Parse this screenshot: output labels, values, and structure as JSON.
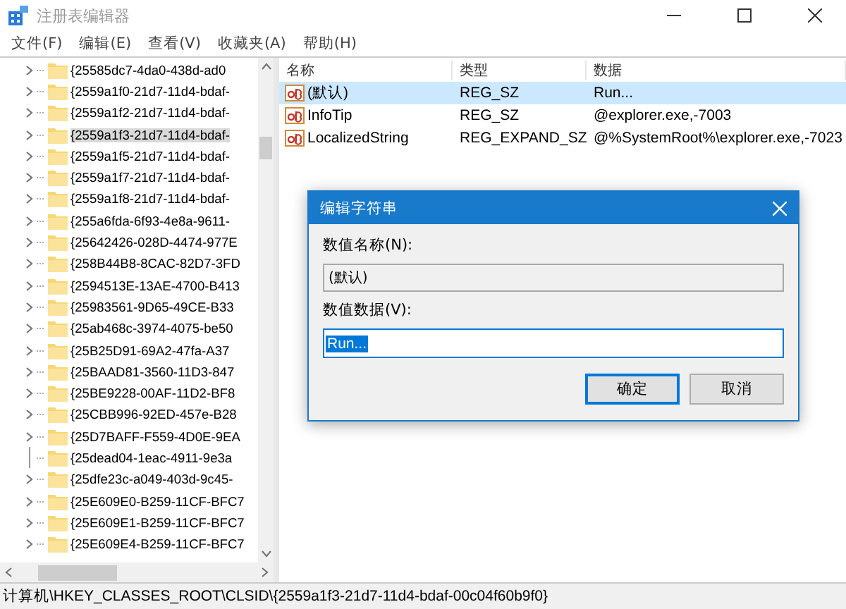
{
  "window": {
    "title": "注册表编辑器"
  },
  "menu": [
    "文件(F)",
    "编辑(E)",
    "查看(V)",
    "收藏夹(A)",
    "帮助(H)"
  ],
  "tree": {
    "items": [
      {
        "label": "{25585dc7-4da0-438d-ad0",
        "selected": false,
        "expandable": true
      },
      {
        "label": "{2559a1f0-21d7-11d4-bdaf-",
        "selected": false,
        "expandable": true
      },
      {
        "label": "{2559a1f2-21d7-11d4-bdaf-",
        "selected": false,
        "expandable": true
      },
      {
        "label": "{2559a1f3-21d7-11d4-bdaf-",
        "selected": true,
        "expandable": true
      },
      {
        "label": "{2559a1f5-21d7-11d4-bdaf-",
        "selected": false,
        "expandable": true
      },
      {
        "label": "{2559a1f7-21d7-11d4-bdaf-",
        "selected": false,
        "expandable": true
      },
      {
        "label": "{2559a1f8-21d7-11d4-bdaf-",
        "selected": false,
        "expandable": true
      },
      {
        "label": "{255a6fda-6f93-4e8a-9611-",
        "selected": false,
        "expandable": true
      },
      {
        "label": "{25642426-028D-4474-977E",
        "selected": false,
        "expandable": true
      },
      {
        "label": "{258B44B8-8CAC-82D7-3FD",
        "selected": false,
        "expandable": true
      },
      {
        "label": "{2594513E-13AE-4700-B413",
        "selected": false,
        "expandable": true
      },
      {
        "label": "{25983561-9D65-49CE-B33",
        "selected": false,
        "expandable": true
      },
      {
        "label": "{25ab468c-3974-4075-be50",
        "selected": false,
        "expandable": true
      },
      {
        "label": "{25B25D91-69A2-47fa-A37",
        "selected": false,
        "expandable": true
      },
      {
        "label": "{25BAAD81-3560-11D3-847",
        "selected": false,
        "expandable": true
      },
      {
        "label": "{25BE9228-00AF-11D2-BF8",
        "selected": false,
        "expandable": true
      },
      {
        "label": "{25CBB996-92ED-457e-B28",
        "selected": false,
        "expandable": true
      },
      {
        "label": "{25D7BAFF-F559-4D0E-9EA",
        "selected": false,
        "expandable": true
      },
      {
        "label": "{25dead04-1eac-4911-9e3a",
        "selected": false,
        "expandable": false
      },
      {
        "label": "{25dfe23c-a049-403d-9c45-",
        "selected": false,
        "expandable": true
      },
      {
        "label": "{25E609E0-B259-11CF-BFC7",
        "selected": false,
        "expandable": true
      },
      {
        "label": "{25E609E1-B259-11CF-BFC7",
        "selected": false,
        "expandable": true
      },
      {
        "label": "{25E609E4-B259-11CF-BFC7",
        "selected": false,
        "expandable": true
      }
    ]
  },
  "values": {
    "columns": [
      "名称",
      "类型",
      "数据"
    ],
    "rows": [
      {
        "name": "(默认)",
        "type": "REG_SZ",
        "data": "Run...",
        "selected": true
      },
      {
        "name": "InfoTip",
        "type": "REG_SZ",
        "data": "@explorer.exe,-7003",
        "selected": false
      },
      {
        "name": "LocalizedString",
        "type": "REG_EXPAND_SZ",
        "data": "@%SystemRoot%\\explorer.exe,-7023",
        "selected": false
      }
    ]
  },
  "dialog": {
    "title": "编辑字符串",
    "name_label": "数值名称(N):",
    "name_value": "(默认)",
    "data_label": "数值数据(V):",
    "data_value": "Run...",
    "buttons": [
      {
        "label": "确定",
        "focused": true
      },
      {
        "label": "取消",
        "focused": false
      }
    ]
  },
  "status_bar": "计算机\\HKEY_CLASSES_ROOT\\CLSID\\{2559a1f3-21d7-11d4-bdaf-00c04f60b9f0}"
}
